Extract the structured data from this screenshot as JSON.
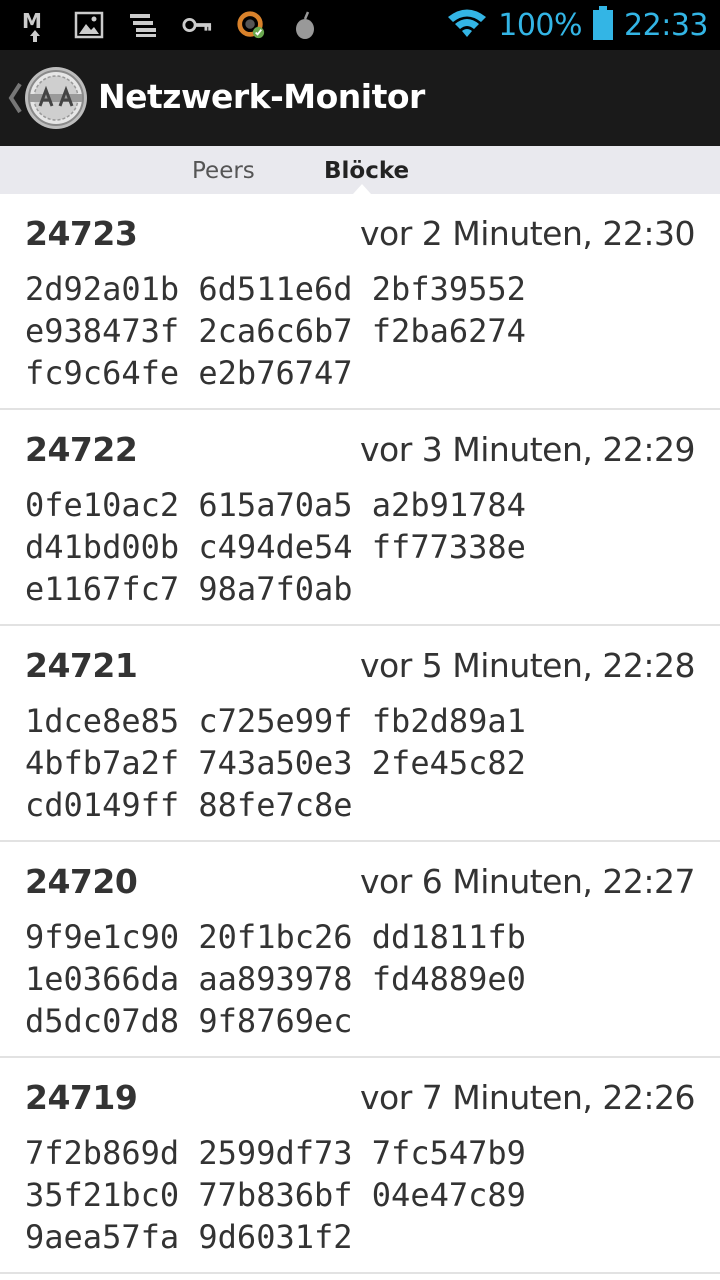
{
  "status_bar": {
    "icons": [
      "gmail-icon",
      "image-icon",
      "storage-icon",
      "key-icon",
      "sync-icon",
      "app-icon"
    ],
    "battery": "100%",
    "time": "22:33"
  },
  "action_bar": {
    "title": "Netzwerk-Monitor"
  },
  "tabs": [
    {
      "label": "Peers",
      "active": false
    },
    {
      "label": "Blöcke",
      "active": true
    }
  ],
  "blocks": [
    {
      "height": "24723",
      "time": "vor 2 Minuten, 22:30",
      "hash": [
        "2d92a01b 6d511e6d 2bf39552",
        "e938473f 2ca6c6b7 f2ba6274",
        "fc9c64fe e2b76747"
      ]
    },
    {
      "height": "24722",
      "time": "vor 3 Minuten, 22:29",
      "hash": [
        "0fe10ac2 615a70a5 a2b91784",
        "d41bd00b c494de54 ff77338e",
        "e1167fc7 98a7f0ab"
      ]
    },
    {
      "height": "24721",
      "time": "vor 5 Minuten, 22:28",
      "hash": [
        "1dce8e85 c725e99f fb2d89a1",
        "4bfb7a2f 743a50e3 2fe45c82",
        "cd0149ff 88fe7c8e"
      ]
    },
    {
      "height": "24720",
      "time": "vor 6 Minuten, 22:27",
      "hash": [
        "9f9e1c90 20f1bc26 dd1811fb",
        "1e0366da aa893978 fd4889e0",
        "d5dc07d8 9f8769ec"
      ]
    },
    {
      "height": "24719",
      "time": "vor 7 Minuten, 22:26",
      "hash": [
        "7f2b869d 2599df73 7fc547b9",
        "35f21bc0 77b836bf 04e47c89",
        "9aea57fa 9d6031f2"
      ]
    }
  ],
  "colors": {
    "status_accent": "#33b5e5",
    "action_bar": "#1a1a1a",
    "tab_strip": "#e9e9ee"
  }
}
